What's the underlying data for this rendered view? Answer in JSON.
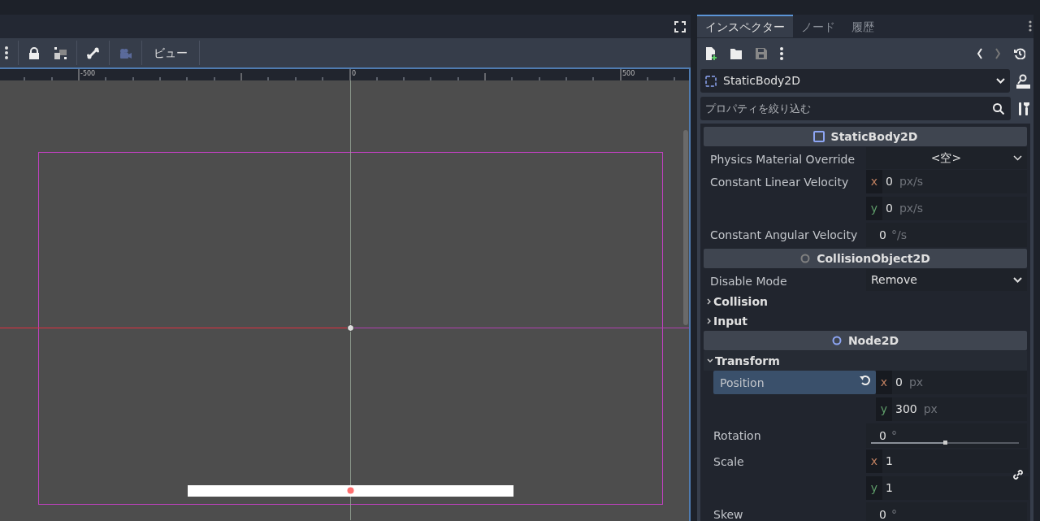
{
  "editor": {
    "view_menu": "ビュー",
    "ruler_labels": [
      "-500",
      "0",
      "500"
    ]
  },
  "inspector": {
    "tabs": [
      {
        "label": "インスペクター",
        "selected": true
      },
      {
        "label": "ノード",
        "selected": false
      },
      {
        "label": "履歴",
        "selected": false
      }
    ],
    "node_selector": "StaticBody2D",
    "filter": {
      "placeholder": "プロパティを絞り込む"
    },
    "properties": [
      {
        "kind": "header",
        "title": "StaticBody2D",
        "square_icon": true,
        "color": "#8da5f3"
      },
      {
        "kind": "resource",
        "label": "Physics Material Override",
        "value": "<空>"
      },
      {
        "kind": "vector2",
        "label": "Constant Linear Velocity",
        "axes": [
          {
            "axis": "x",
            "value": "0",
            "unit": "px/s"
          },
          {
            "axis": "y",
            "value": "0",
            "unit": "px/s"
          }
        ],
        "modified": false,
        "linked": false
      },
      {
        "kind": "number",
        "label": "Constant Angular Velocity",
        "value": "0",
        "unit": "°/s"
      },
      {
        "kind": "header",
        "title": "CollisionObject2D",
        "square_icon": false,
        "color": "#808080"
      },
      {
        "kind": "enum",
        "label": "Disable Mode",
        "value": "Remove"
      },
      {
        "kind": "group",
        "title": "Collision",
        "expanded": false
      },
      {
        "kind": "group",
        "title": "Input",
        "expanded": false
      },
      {
        "kind": "header",
        "title": "Node2D",
        "square_icon": false,
        "color": "#8da5f3"
      },
      {
        "kind": "group",
        "title": "Transform",
        "expanded": true,
        "children": [
          {
            "kind": "vector2",
            "label": "Position",
            "axes": [
              {
                "axis": "x",
                "value": "0",
                "unit": "px"
              },
              {
                "axis": "y",
                "value": "300",
                "unit": "px"
              }
            ],
            "modified": true,
            "linked": false
          },
          {
            "kind": "number",
            "label": "Rotation",
            "value": "0",
            "unit": "°",
            "level": 0.5
          },
          {
            "kind": "vector2",
            "label": "Scale",
            "axes": [
              {
                "axis": "x",
                "value": "1"
              },
              {
                "axis": "y",
                "value": "1"
              }
            ],
            "modified": false,
            "linked": true
          },
          {
            "kind": "number",
            "label": "Skew",
            "value": "0",
            "unit": "°"
          }
        ]
      }
    ]
  }
}
